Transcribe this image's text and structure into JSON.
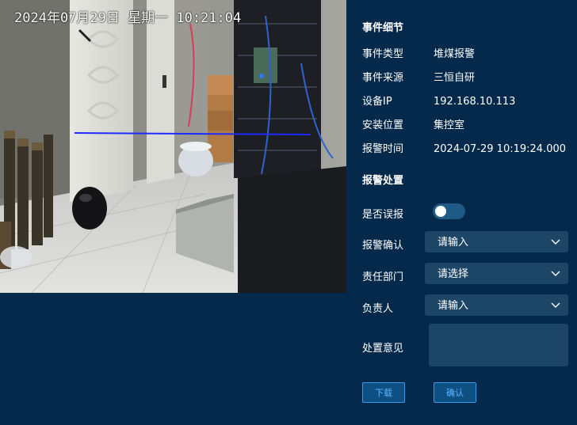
{
  "camera": {
    "timestamp": "2024年07月29日  星期一  10:21:04"
  },
  "panel": {
    "title": "事件细节",
    "details": [
      {
        "label": "事件类型",
        "value": "堆煤报警"
      },
      {
        "label": "事件来源",
        "value": "三恒自研"
      },
      {
        "label": "设备IP",
        "value": "192.168.10.113"
      },
      {
        "label": "安装位置",
        "value": "集控室"
      },
      {
        "label": "报警时间",
        "value": "2024-07-29 10:19:24.000"
      }
    ]
  },
  "handling": {
    "title": "报警处置",
    "false_alarm_label": "是否误报",
    "false_alarm_value": false,
    "confirm_label": "报警确认",
    "confirm_placeholder": "请输入",
    "department_label": "责任部门",
    "department_placeholder": "请选择",
    "owner_label": "负责人",
    "owner_placeholder": "请输入",
    "opinion_label": "处置意见",
    "opinion_value": ""
  },
  "buttons": {
    "download": "下载",
    "confirm": "确认"
  },
  "colors": {
    "background": "#04294a",
    "input_bg": "#1d4566",
    "button_border": "#3b9ae6",
    "button_text": "#5cb6ff",
    "toggle_off": "#1d5a86"
  },
  "icons": {
    "select_arrow": "chevron-down-icon"
  }
}
